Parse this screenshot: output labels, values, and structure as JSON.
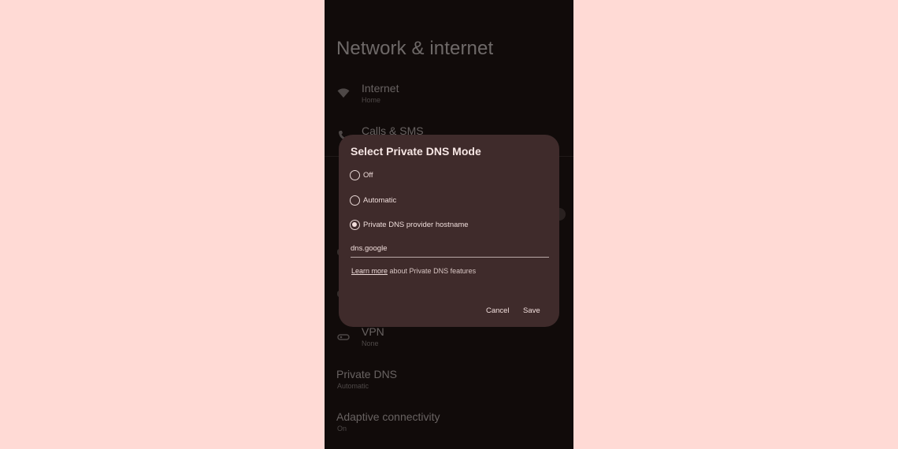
{
  "page": {
    "title": "Network & internet"
  },
  "settings": [
    {
      "title": "Internet",
      "subtitle": "Home"
    },
    {
      "title": "Calls & SMS",
      "subtitle": ""
    },
    {
      "title": "VPN",
      "subtitle": "None"
    },
    {
      "title": "Private DNS",
      "subtitle": "Automatic"
    },
    {
      "title": "Adaptive connectivity",
      "subtitle": "On"
    }
  ],
  "dialog": {
    "title": "Select Private DNS Mode",
    "options": [
      {
        "label": "Off",
        "selected": false
      },
      {
        "label": "Automatic",
        "selected": false
      },
      {
        "label": "Private DNS provider hostname",
        "selected": true
      }
    ],
    "hostname_value": "dns.google",
    "learn_more_link": "Learn more",
    "learn_more_suffix": " about Private DNS features",
    "cancel_label": "Cancel",
    "save_label": "Save"
  },
  "colors": {
    "background": "#ffdad5",
    "screen": "#1f1413",
    "dialog": "#3f2b2b"
  },
  "icons": [
    "wifi-icon",
    "phone-icon",
    "vpn-key-icon"
  ]
}
